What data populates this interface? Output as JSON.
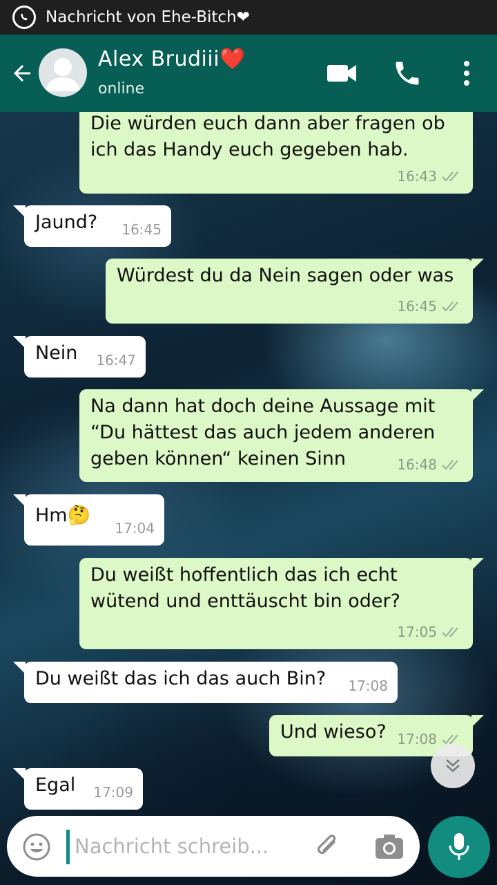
{
  "notification": {
    "text": "Nachricht von Ehe-Bitch❤",
    "icon": "whatsapp-icon"
  },
  "header": {
    "contact_name": "Alex Brudiii❤️",
    "status": "online",
    "icons": [
      "back-arrow-icon",
      "avatar",
      "video-call-icon",
      "phone-icon",
      "more-vert-icon"
    ]
  },
  "colors": {
    "header": "#075e54",
    "outgoing_bubble": "#dcf8c6",
    "incoming_bubble": "#ffffff",
    "accent": "#128c7e"
  },
  "messages": [
    {
      "direction": "out",
      "text": "Die würden euch dann aber fragen ob\nich das Handy euch gegeben hab.",
      "time": "16:43"
    },
    {
      "direction": "in",
      "text": "Jaund?",
      "time": "16:45"
    },
    {
      "direction": "out",
      "text": "Würdest du da Nein sagen oder was",
      "time": "16:45"
    },
    {
      "direction": "in",
      "text": "Nein",
      "time": "16:47"
    },
    {
      "direction": "out",
      "text": "Na dann hat doch deine Aussage mit\n“Du hättest das auch jedem anderen\ngeben können“ keinen Sinn",
      "time": "16:48"
    },
    {
      "direction": "in",
      "text": "Hm🤔",
      "time": "17:04"
    },
    {
      "direction": "out",
      "text": "Du weißt hoffentlich das ich echt\nwütend und enttäuscht bin oder?",
      "time": "17:05"
    },
    {
      "direction": "in",
      "text": "Du weißt das ich das auch Bin?",
      "time": "17:08"
    },
    {
      "direction": "out",
      "text": "Und wieso?",
      "time": "17:08"
    },
    {
      "direction": "in",
      "text": "Egal",
      "time": "17:09"
    }
  ],
  "composer": {
    "placeholder": "Nachricht schreib...",
    "icons": [
      "emoji-icon",
      "attach-icon",
      "camera-icon",
      "mic-icon"
    ]
  }
}
